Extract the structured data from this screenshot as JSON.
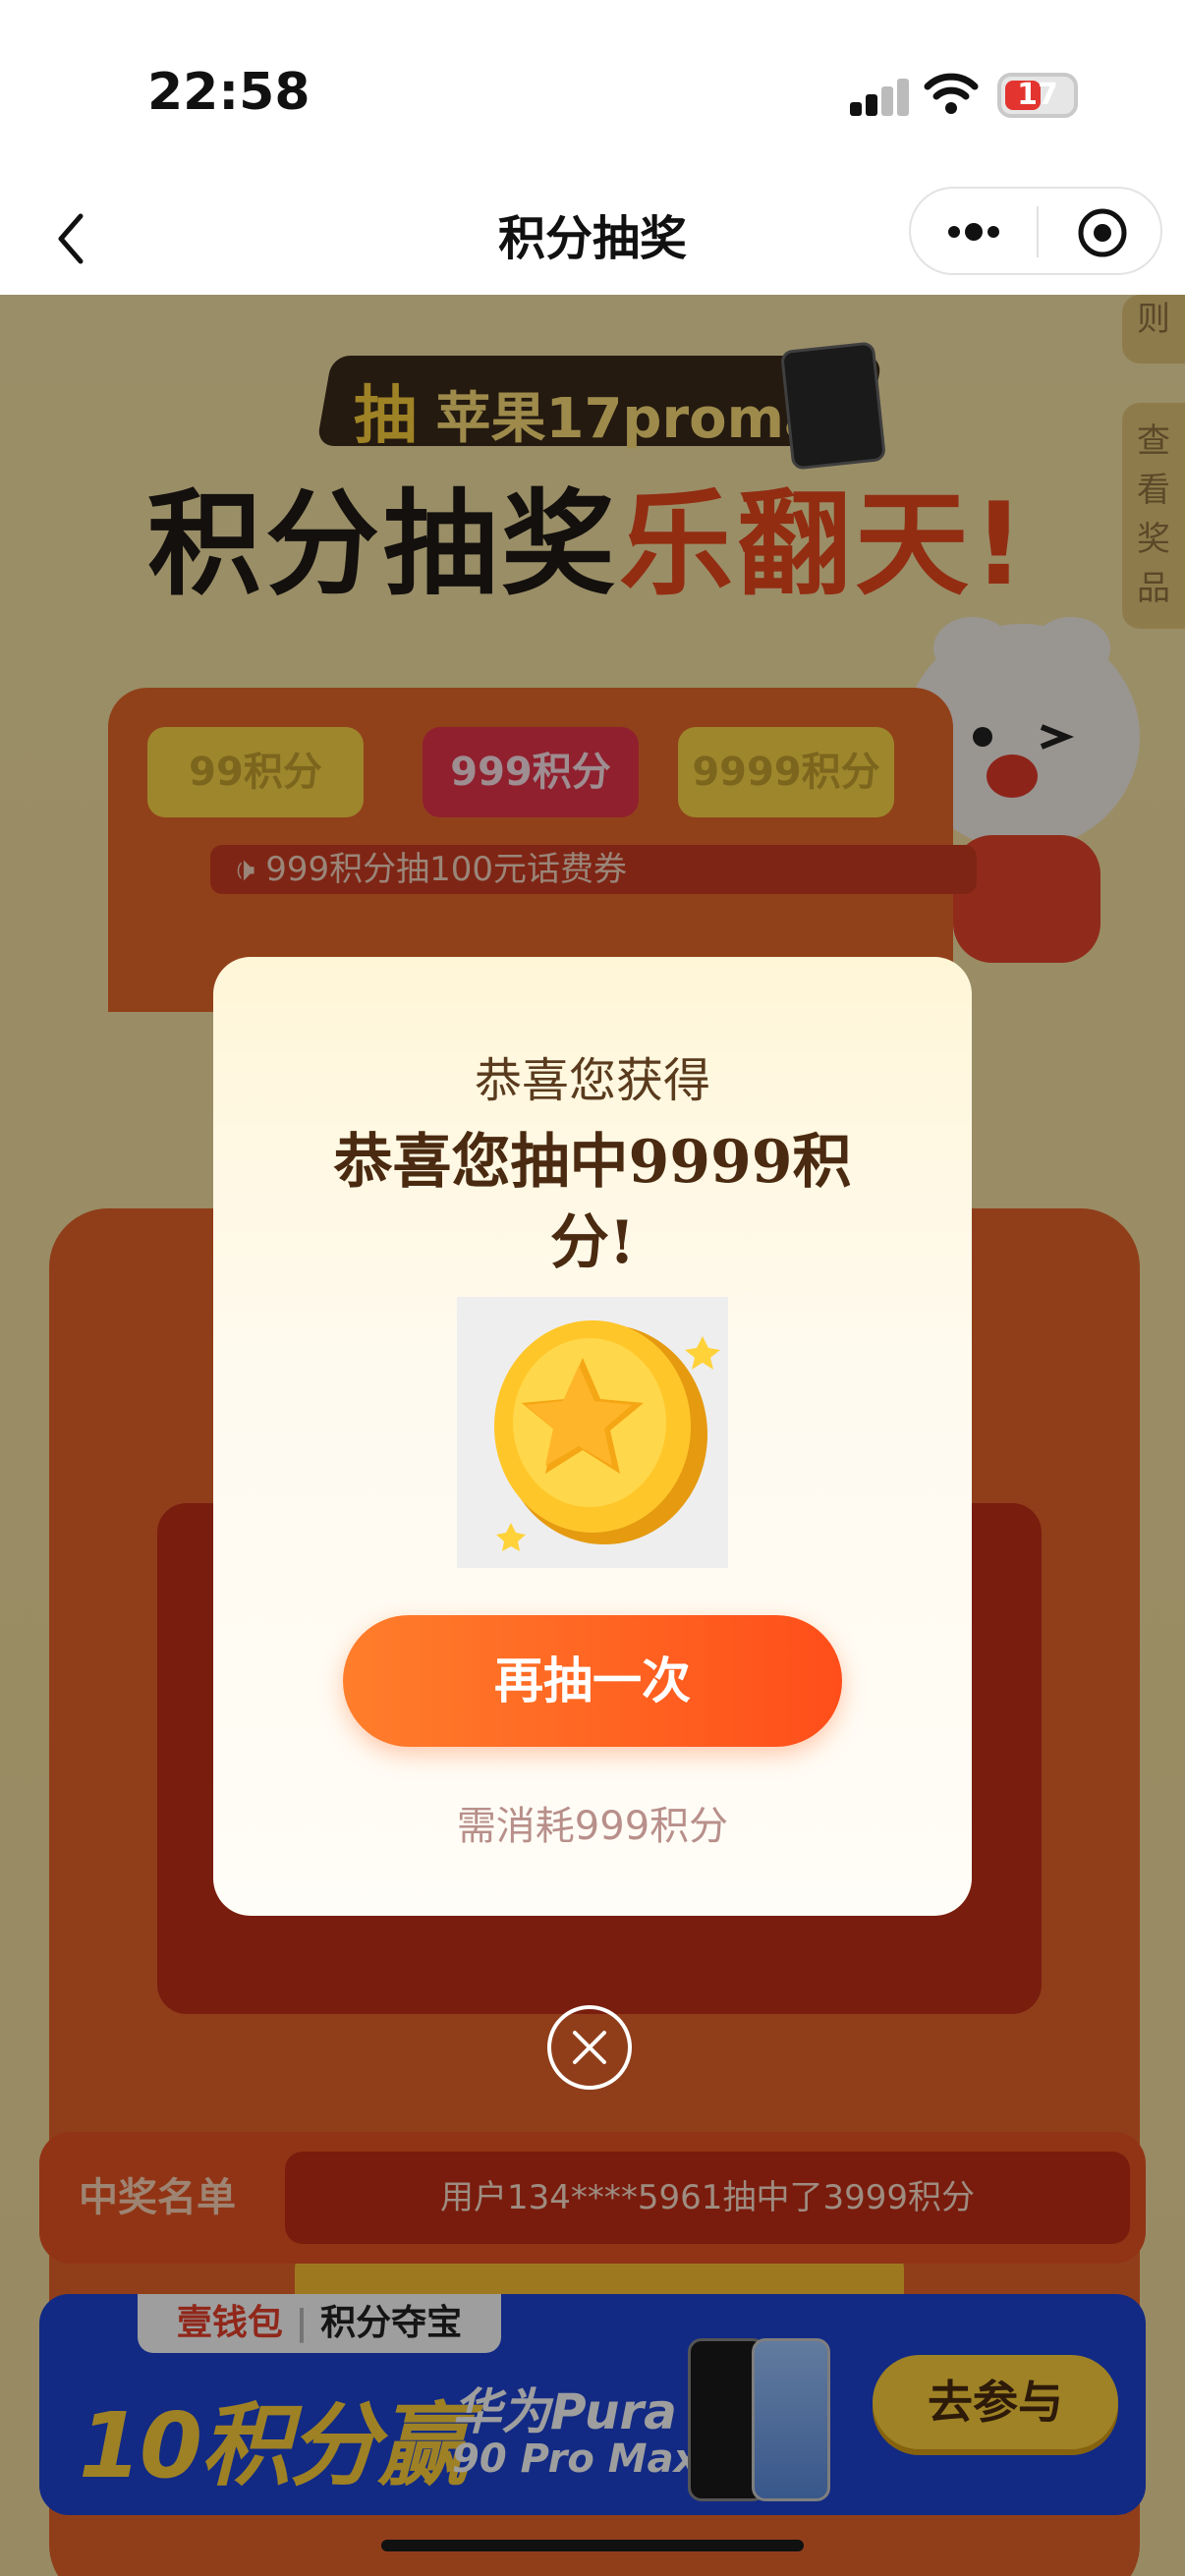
{
  "status_bar": {
    "time": "22:58",
    "battery": "17"
  },
  "nav": {
    "title": "积分抽奖"
  },
  "hero": {
    "tag_prefix": "抽",
    "tag_text": "苹果17promax",
    "title_main": "积分抽奖",
    "title_accent": "乐翻天!"
  },
  "side_tabs": {
    "rules_tail": "则",
    "view_prizes": "查看奖品"
  },
  "tiers": [
    "99积分",
    "999积分",
    "9999积分"
  ],
  "marquee": "🕩 999积分抽100元话费券",
  "winners": {
    "label": "中奖名单",
    "text": "用户134****5961抽中了3999积分"
  },
  "banner": {
    "tag_left": "壹钱包",
    "tag_right": "积分夺宝",
    "main": "10积分赢",
    "product_line1": "华为Pura",
    "product_line2": "90 Pro Max",
    "cta": "去参与"
  },
  "modal": {
    "subtitle": "恭喜您获得",
    "title": "恭喜您抽中9999积分!",
    "button": "再抽一次",
    "cost_note": "需消耗999积分"
  },
  "colors": {
    "accent_orange": "#ff5a1f",
    "brown_text": "#4a2a10",
    "overlay": "rgba(0,0,0,0.38)"
  }
}
